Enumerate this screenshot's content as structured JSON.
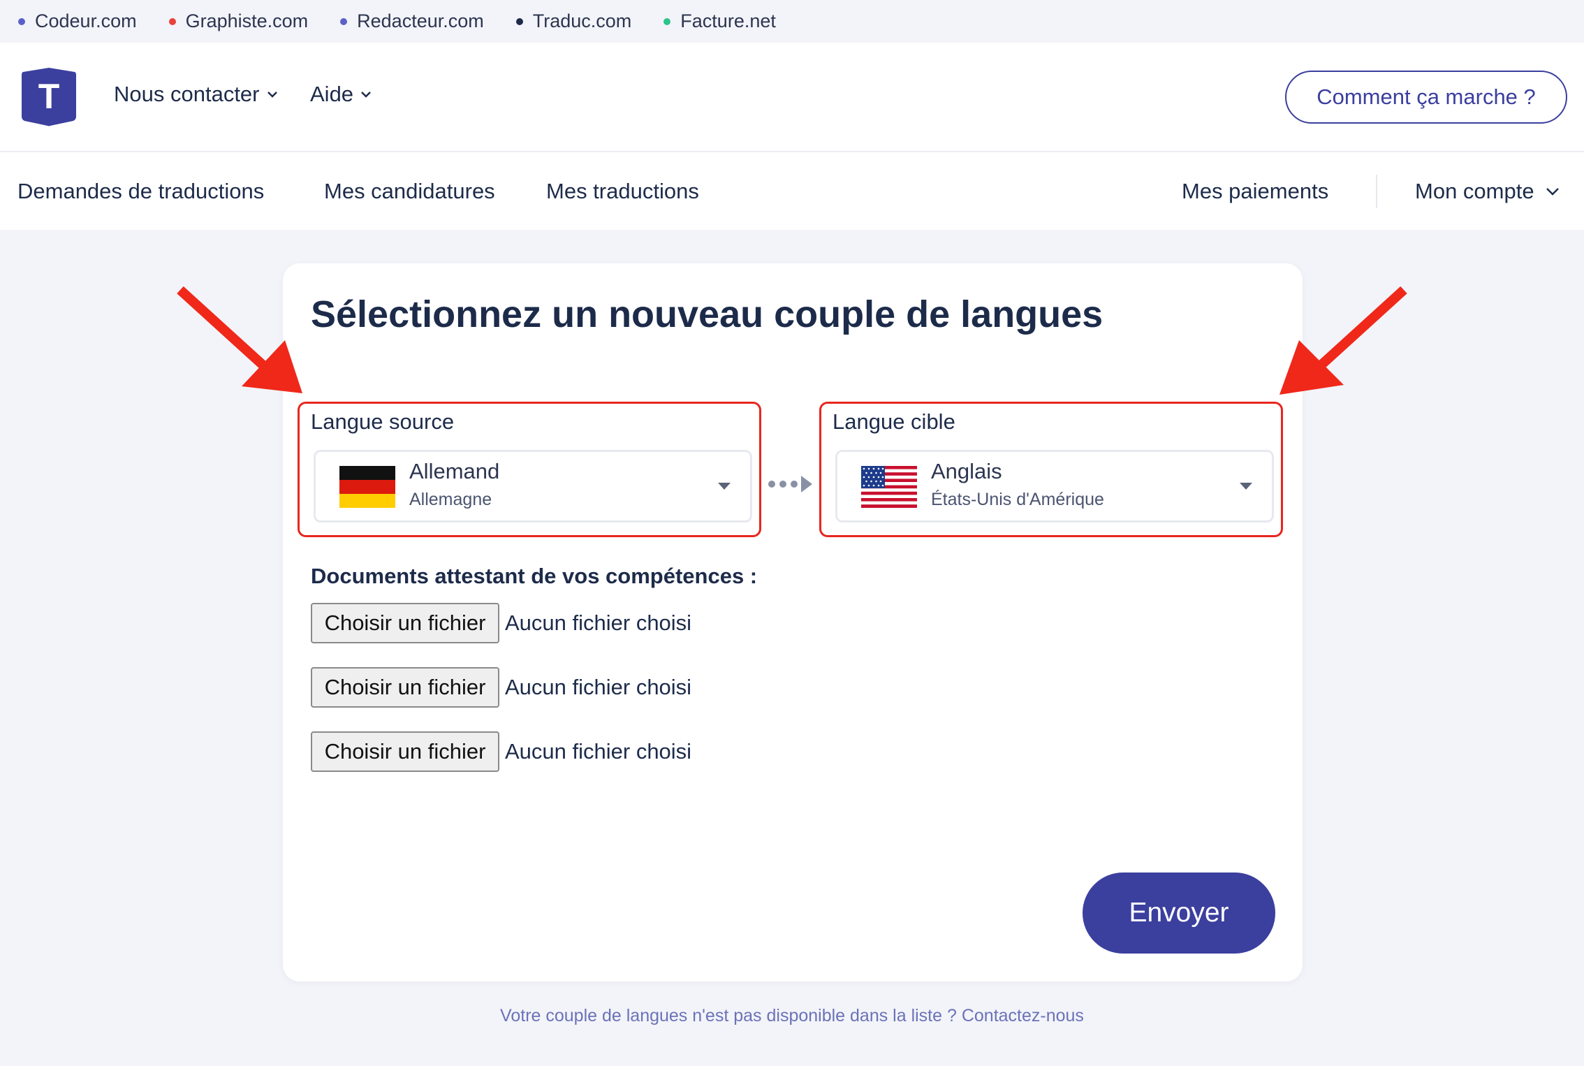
{
  "network_bar": {
    "links": [
      {
        "label": "Codeur.com",
        "color": "#5b60c9"
      },
      {
        "label": "Graphiste.com",
        "color": "#e8423a"
      },
      {
        "label": "Redacteur.com",
        "color": "#5b60c9"
      },
      {
        "label": "Traduc.com",
        "color": "#1d2b4a"
      },
      {
        "label": "Facture.net",
        "color": "#2ec48c"
      }
    ]
  },
  "header": {
    "logo_letter": "T",
    "menu": {
      "contact": "Nous contacter",
      "help": "Aide"
    },
    "how_it_works": "Comment ça marche ?"
  },
  "subnav": {
    "items": [
      "Demandes de traductions",
      "Mes candidatures",
      "Mes traductions"
    ],
    "payments": "Mes paiements",
    "account": "Mon compte"
  },
  "form": {
    "title": "Sélectionnez un nouveau couple de langues",
    "source": {
      "label": "Langue source",
      "language": "Allemand",
      "country": "Allemagne",
      "flag": "germany-flag"
    },
    "target": {
      "label": "Langue cible",
      "language": "Anglais",
      "country": "États-Unis d'Amérique",
      "flag": "usa-flag"
    },
    "documents_label": "Documents attestant de vos compétences :",
    "files": [
      {
        "button": "Choisir un fichier",
        "status": "Aucun fichier choisi"
      },
      {
        "button": "Choisir un fichier",
        "status": "Aucun fichier choisi"
      },
      {
        "button": "Choisir un fichier",
        "status": "Aucun fichier choisi"
      }
    ],
    "submit": "Envoyer"
  },
  "footer_note": "Votre couple de langues n'est pas disponible dans la liste ? Contactez-nous",
  "colors": {
    "brand": "#3b3f9e",
    "annotation": "#e8261f",
    "background": "#f3f4f9"
  }
}
